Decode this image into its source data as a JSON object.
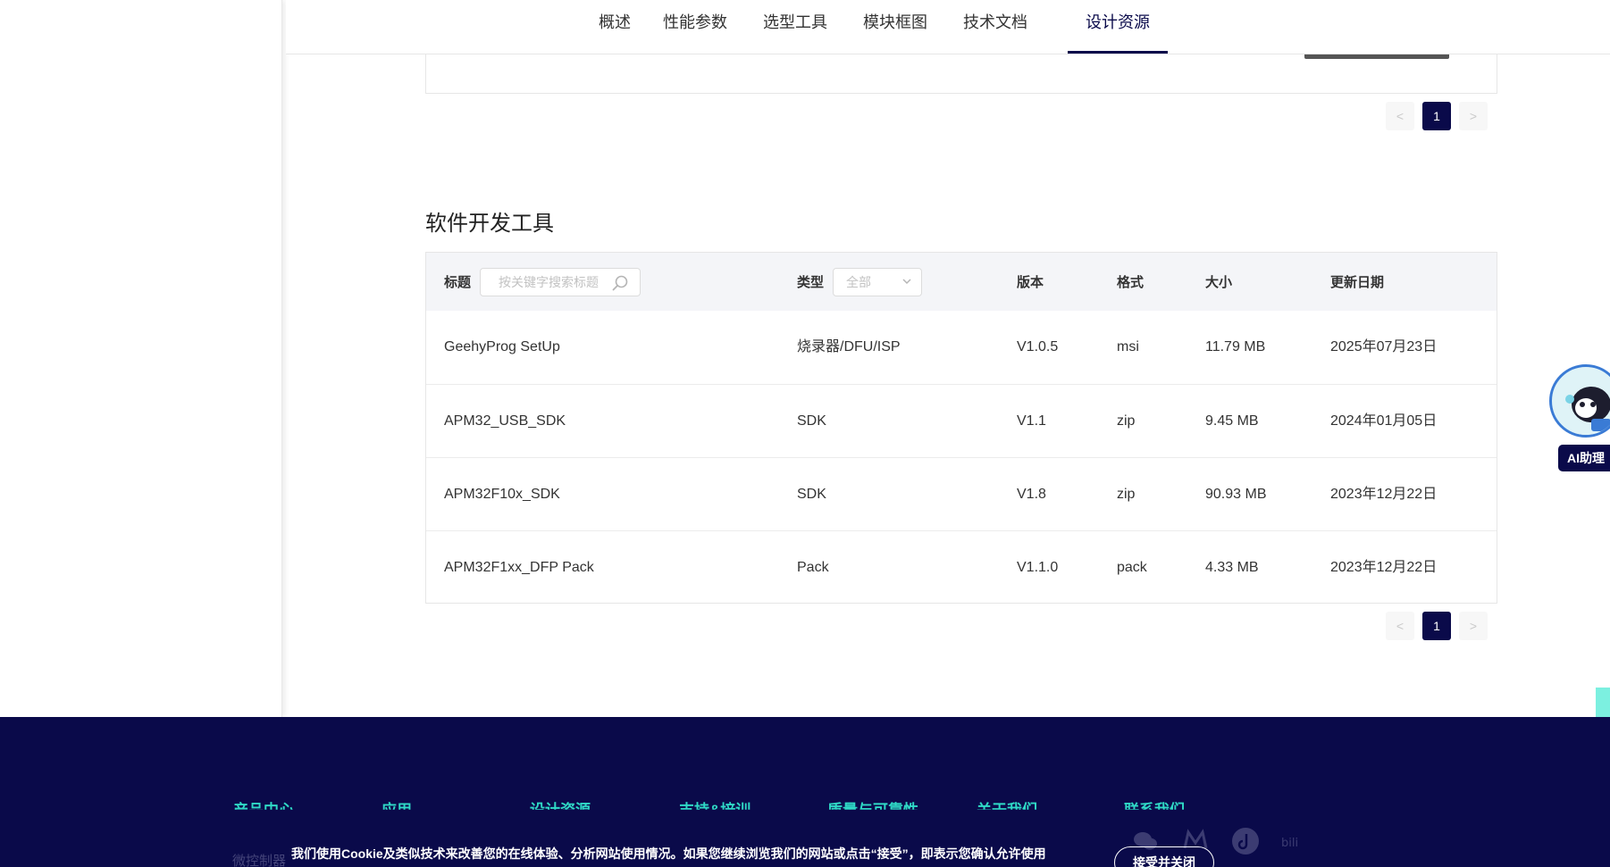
{
  "tabs": {
    "items": [
      {
        "label": "概述"
      },
      {
        "label": "性能参数"
      },
      {
        "label": "选型工具"
      },
      {
        "label": "模块框图"
      },
      {
        "label": "技术文档"
      },
      {
        "label": "设计资源"
      }
    ],
    "active": "设计资源"
  },
  "pagination_top": {
    "prev": "<",
    "page": "1",
    "next": ">"
  },
  "section": {
    "title": "软件开发工具"
  },
  "table": {
    "headers": {
      "title": "标题",
      "type": "类型",
      "version": "版本",
      "format": "格式",
      "size": "大小",
      "date": "更新日期"
    },
    "search_placeholder": "按关键字搜索标题",
    "type_filter_value": "全部",
    "rows": [
      {
        "title": "GeehyProg SetUp",
        "type": "烧录器/DFU/ISP",
        "version": "V1.0.5",
        "format": "msi",
        "size": "11.79 MB",
        "date": "2025年07月23日"
      },
      {
        "title": "APM32_USB_SDK",
        "type": "SDK",
        "version": "V1.1",
        "format": "zip",
        "size": "9.45 MB",
        "date": "2024年01月05日"
      },
      {
        "title": "APM32F10x_SDK",
        "type": "SDK",
        "version": "V1.8",
        "format": "zip",
        "size": "90.93 MB",
        "date": "2023年12月22日"
      },
      {
        "title": "APM32F1xx_DFP Pack",
        "type": "Pack",
        "version": "V1.1.0",
        "format": "pack",
        "size": "4.33 MB",
        "date": "2023年12月22日"
      }
    ]
  },
  "pagination_bottom": {
    "prev": "<",
    "page": "1",
    "next": ">"
  },
  "ai": {
    "label": "AI助理"
  },
  "footer": {
    "columns": [
      "产品中心",
      "应用",
      "设计资源",
      "支持&培训",
      "质量与可靠性",
      "关于我们",
      "联系我们"
    ],
    "sub_item": "微控制器"
  },
  "cookie": {
    "text": "我们使用Cookie及类似技术来改善您的在线体验、分析网站使用情况。如果您继续浏览我们的网站或点击“接受”，即表示您确认允许使用",
    "button": "接受并关闭"
  },
  "colors": {
    "brand": "#0a0a4a",
    "accent": "#2fd9c6"
  }
}
